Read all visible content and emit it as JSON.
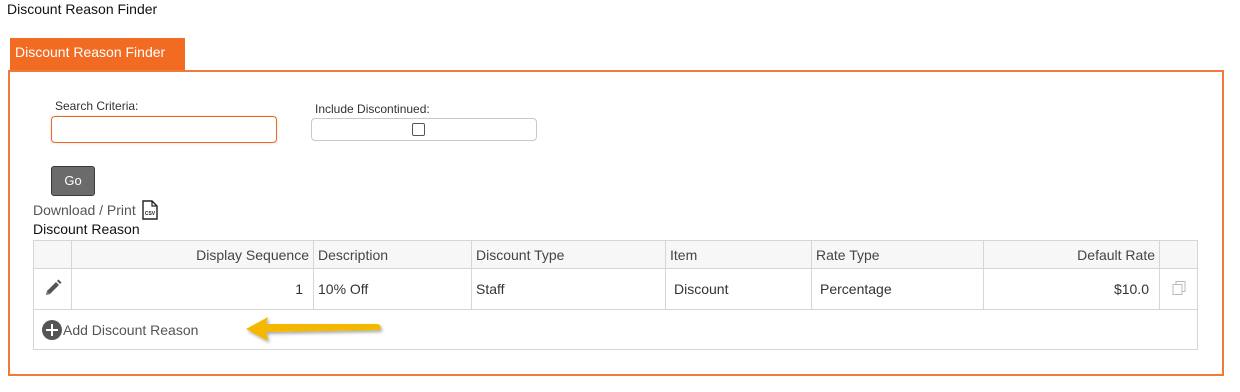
{
  "page": {
    "title": "Discount Reason Finder"
  },
  "tab": {
    "label": "Discount Reason Finder"
  },
  "search": {
    "criteria_label": "Search Criteria:",
    "criteria_value": "",
    "discontinued_label": "Include Discontinued:",
    "discontinued_checked": false,
    "go_label": "Go"
  },
  "download": {
    "label": "Download / Print",
    "icon": "csv-file-icon"
  },
  "grid": {
    "title": "Discount Reason",
    "columns": [
      "Display Sequence",
      "Description",
      "Discount Type",
      "Item",
      "Rate Type",
      "Default Rate"
    ],
    "rows": [
      {
        "sequence": "1",
        "description": "10% Off",
        "discount_type": "Staff",
        "item": "Discount",
        "rate_type": "Percentage",
        "default_rate": "$10.0"
      }
    ],
    "add_label": "Add Discount Reason"
  },
  "colors": {
    "accent": "#f26b22",
    "button": "#6b6b6b",
    "arrow": "#f5b800"
  }
}
